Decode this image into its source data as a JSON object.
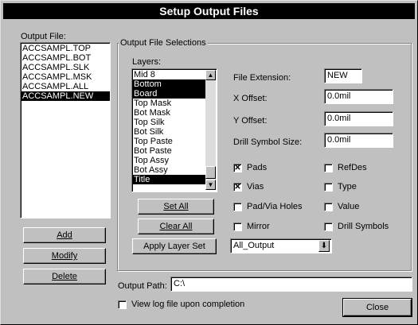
{
  "window": {
    "title": "Setup Output Files"
  },
  "output_file": {
    "label": "Output File:",
    "items": [
      "ACCSAMPL.TOP",
      "ACCSAMPL.BOT",
      "ACCSAMPL.SLK",
      "ACCSAMPL.MSK",
      "ACCSAMPL.ALL",
      "ACCSAMPL.NEW"
    ],
    "selected": "ACCSAMPL.NEW"
  },
  "left_buttons": {
    "add": "Add",
    "modify": "Modify",
    "delete": "Delete"
  },
  "selections_group": {
    "title": "Output File Selections",
    "layers_label": "Layers:",
    "layers": [
      "Mid 8",
      "Bottom",
      "Board",
      "Top Mask",
      "Bot Mask",
      "Top Silk",
      "Bot Silk",
      "Top Paste",
      "Bot Paste",
      "Top Assy",
      "Bot Assy",
      "Title"
    ],
    "selected_layers": [
      "Bottom",
      "Board",
      "Title"
    ]
  },
  "fields": {
    "file_extension_label": "File Extension:",
    "file_extension_value": "NEW",
    "x_offset_label": "X Offset:",
    "x_offset_value": "0.0mil",
    "y_offset_label": "Y Offset:",
    "y_offset_value": "0.0mil",
    "drill_symbol_size_label": "Drill Symbol Size:",
    "drill_symbol_size_value": "0.0mil"
  },
  "checkboxes": {
    "pads": {
      "label": "Pads",
      "checked": true
    },
    "refdes": {
      "label": "RefDes",
      "checked": false
    },
    "vias": {
      "label": "Vias",
      "checked": true
    },
    "type": {
      "label": "Type",
      "checked": false
    },
    "pad_via_holes": {
      "label": "Pad/Via Holes",
      "checked": false
    },
    "value": {
      "label": "Value",
      "checked": false
    },
    "mirror": {
      "label": "Mirror",
      "checked": false
    },
    "drill_symbols": {
      "label": "Drill Symbols",
      "checked": false
    }
  },
  "layer_buttons": {
    "set_all": "Set All",
    "clear_all": "Clear All",
    "apply_layer_set": "Apply Layer Set"
  },
  "layer_set_dropdown": {
    "value": "All_Output"
  },
  "output_path": {
    "label": "Output Path:",
    "value": "C:\\"
  },
  "view_log": {
    "label": "View log file upon completion",
    "checked": false
  },
  "close_button": "Close",
  "glyphs": {
    "check": "✕",
    "scroll_up": "▲",
    "scroll_down": "▼",
    "dropdown": "⬇"
  }
}
